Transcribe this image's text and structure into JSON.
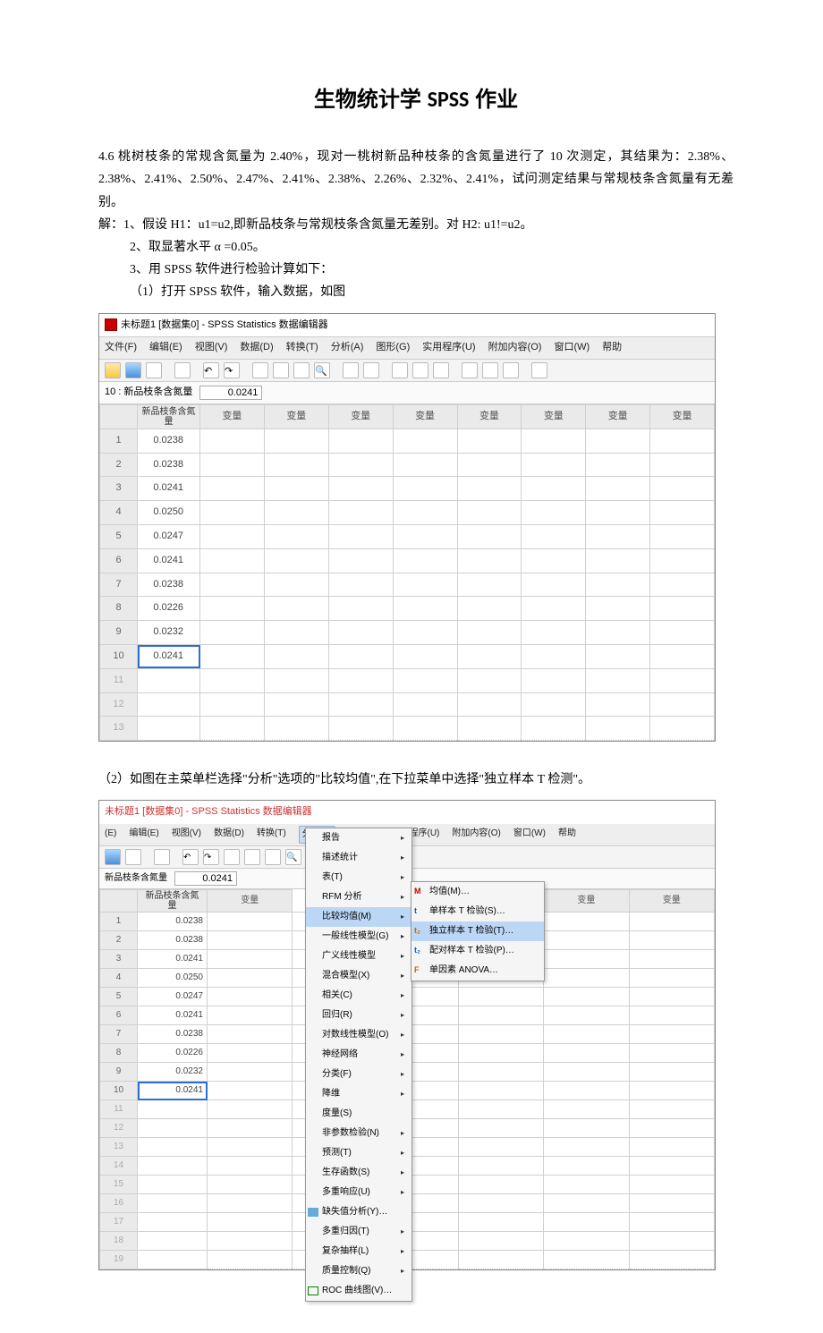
{
  "title_cn": "生物统计学 ",
  "title_en": "SPSS",
  "title_suffix": " 作业",
  "problem": "4.6 桃树枝条的常规含氮量为 2.40%，现对一桃树新品种枝条的含氮量进行了 10 次测定，其结果为：2.38%、2.38%、2.41%、2.50%、2.47%、2.41%、2.38%、2.26%、2.32%、2.41%，试问测定结果与常规枝条含氮量有无差别。",
  "sol_line1": "解：1、假设 H1：u1=u2,即新品枝条与常规枝条含氮量无差别。对 H2: u1!=u2。",
  "sol_line2": "2、取显著水平 α =0.05。",
  "sol_line3": "3、用 SPSS 软件进行检验计算如下：",
  "sol_line4": "（1）打开 SPSS 软件，输入数据，如图",
  "sol_line5": "（2）如图在主菜单栏选择\"分析\"选项的\"比较均值\",在下拉菜单中选择\"独立样本 T 检测\"。",
  "spss": {
    "title": "未标题1 [数据集0] - SPSS Statistics 数据编辑器",
    "title2": "未标题1 [数据集0] - SPSS Statistics 数据编辑器",
    "menus": [
      "文件(F)",
      "编辑(E)",
      "视图(V)",
      "数据(D)",
      "转换(T)",
      "分析(A)",
      "图形(G)",
      "实用程序(U)",
      "附加内容(O)",
      "窗口(W)",
      "帮助"
    ],
    "sel_label": "10 : 新品枝条含氮量",
    "sel_label2": "新品枝条含氮量",
    "sel_value": "0.0241",
    "var_header": "新品枝条含氮量",
    "col_blank": "变量",
    "rows": [
      "0.0238",
      "0.0238",
      "0.0241",
      "0.0250",
      "0.0247",
      "0.0241",
      "0.0238",
      "0.0226",
      "0.0232",
      "0.0241"
    ]
  },
  "dropdown": {
    "items": [
      "报告",
      "描述统计",
      "表(T)",
      "RFM 分析",
      "比较均值(M)",
      "一般线性模型(G)",
      "广义线性模型",
      "混合模型(X)",
      "相关(C)",
      "回归(R)",
      "对数线性模型(O)",
      "神经网络",
      "分类(F)",
      "降维",
      "度量(S)",
      "非参数检验(N)",
      "预测(T)",
      "生存函数(S)",
      "多重响应(U)",
      "缺失值分析(Y)…",
      "多重归因(T)",
      "复杂抽样(L)",
      "质量控制(Q)",
      "ROC 曲线图(V)…"
    ],
    "sub": [
      "均值(M)…",
      "单样本 T 检验(S)…",
      "独立样本 T 检验(T)…",
      "配对样本 T 检验(P)…",
      "单因素 ANOVA…"
    ]
  }
}
